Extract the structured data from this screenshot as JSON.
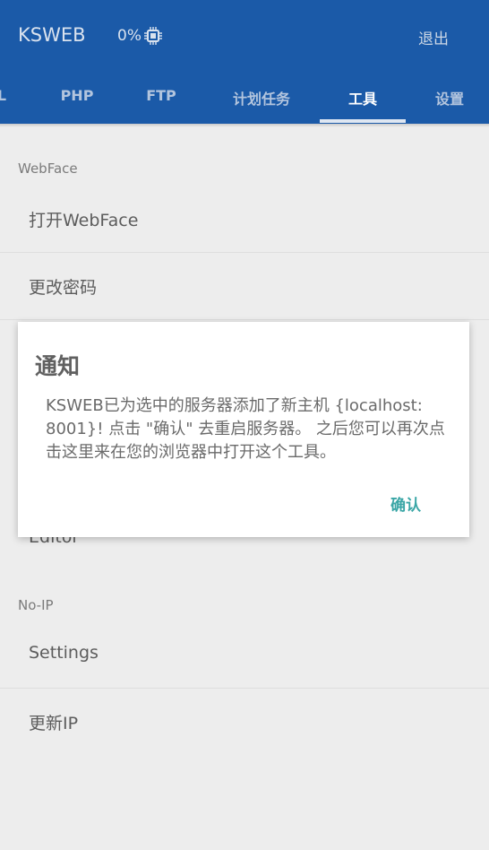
{
  "app": {
    "title": "KSWEB",
    "cpu_usage": "0%",
    "exit_label": "退出",
    "accent_color": "#1b5aa8"
  },
  "tabs": [
    {
      "label": "L",
      "active": false
    },
    {
      "label": "PHP",
      "active": false
    },
    {
      "label": "FTP",
      "active": false
    },
    {
      "label": "计划任务",
      "active": false
    },
    {
      "label": "工具",
      "active": true
    },
    {
      "label": "设置",
      "active": false
    }
  ],
  "sections": {
    "webface": {
      "header": "WebFace",
      "items": [
        "打开WebFace",
        "更改密码"
      ]
    },
    "editor_item": "Editor",
    "noip": {
      "header": "No-IP",
      "items": [
        "Settings",
        "更新IP"
      ]
    }
  },
  "dialog": {
    "title": "通知",
    "message": "KSWEB已为选中的服务器添加了新主机 {localhost: 8001}! 点击 \"确认\" 去重启服务器。 之后您可以再次点击这里来在您的浏览器中打开这个工具。",
    "confirm_label": "确认",
    "confirm_color": "#3aa6a6"
  }
}
